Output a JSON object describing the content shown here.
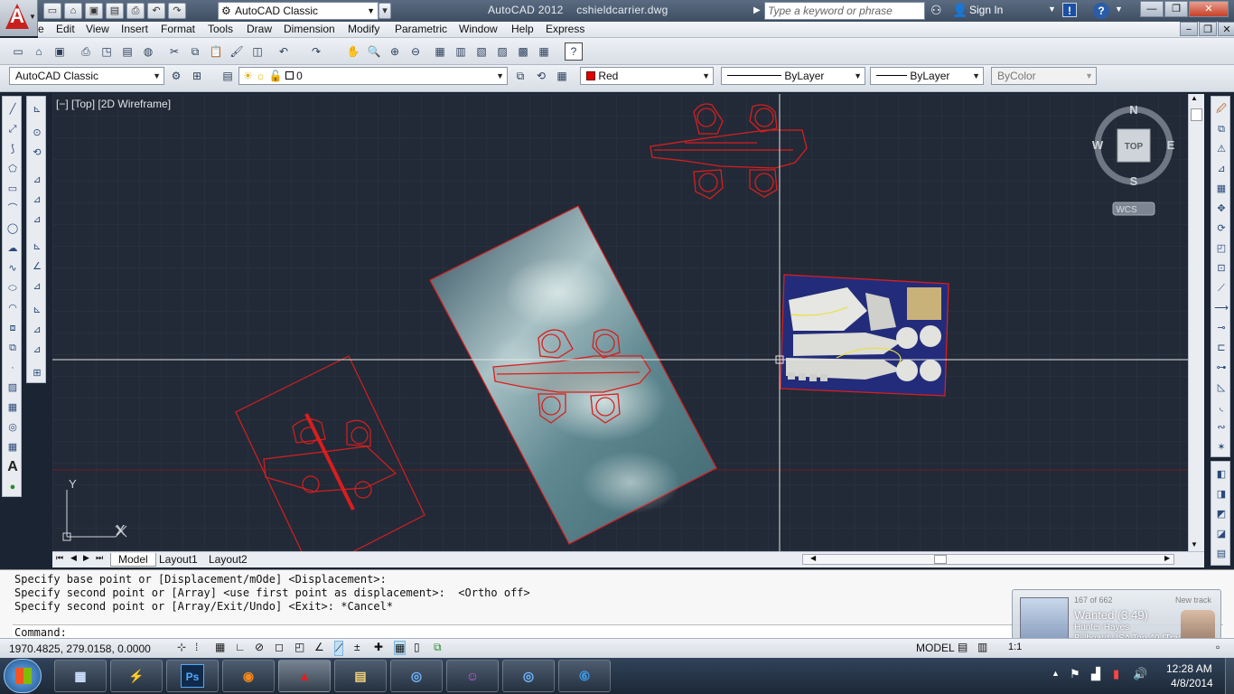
{
  "title": {
    "app_name": "AutoCAD 2012",
    "file_name": "cshieldcarrier.dwg",
    "workspace": "AutoCAD Classic",
    "search_placeholder": "Type a keyword or phrase",
    "sign_in": "Sign In"
  },
  "menu": [
    "e",
    "Edit",
    "View",
    "Insert",
    "Format",
    "Tools",
    "Draw",
    "Dimension",
    "Modify",
    "Parametric",
    "Window",
    "Help",
    "Express"
  ],
  "toolbar2": {
    "workspace": "AutoCAD Classic",
    "layer": "0",
    "color": "Red",
    "color_hex": "#e00000",
    "linetype": "ByLayer",
    "lineweight": "ByLayer",
    "plotstyle": "ByColor"
  },
  "viewport": {
    "label": "[−] [Top] [2D Wireframe]",
    "compass_n": "N",
    "compass_s": "S",
    "compass_e": "E",
    "compass_w": "W",
    "viewcube_face": "TOP",
    "wcs": "WCS",
    "ucs_x": "X",
    "ucs_y": "Y"
  },
  "layout_tabs": [
    "Model",
    "Layout1",
    "Layout2"
  ],
  "command_lines": [
    "Specify base point or [Displacement/mOde] <Displacement>:",
    "Specify second point or [Array] <use first point as displacement>:  <Ortho off>",
    "Specify second point or [Array/Exit/Undo] <Exit>: *Cancel*"
  ],
  "command_prompt": "Command:",
  "status": {
    "coords": "1970.4825, 279.0158, 0.0000",
    "model": "MODEL",
    "scale": "1:1"
  },
  "notification": {
    "count": "167 of 662",
    "label": "New track",
    "song": "Wanted (3:49)",
    "artist": "Hunter Hayes",
    "chart": "Billboard USA Top 40  (Track 24)"
  },
  "taskbar": {
    "apps": [
      "Ps",
      "",
      "",
      "",
      "",
      "",
      "",
      ""
    ],
    "time": "12:28 AM",
    "date": "4/8/2014"
  }
}
